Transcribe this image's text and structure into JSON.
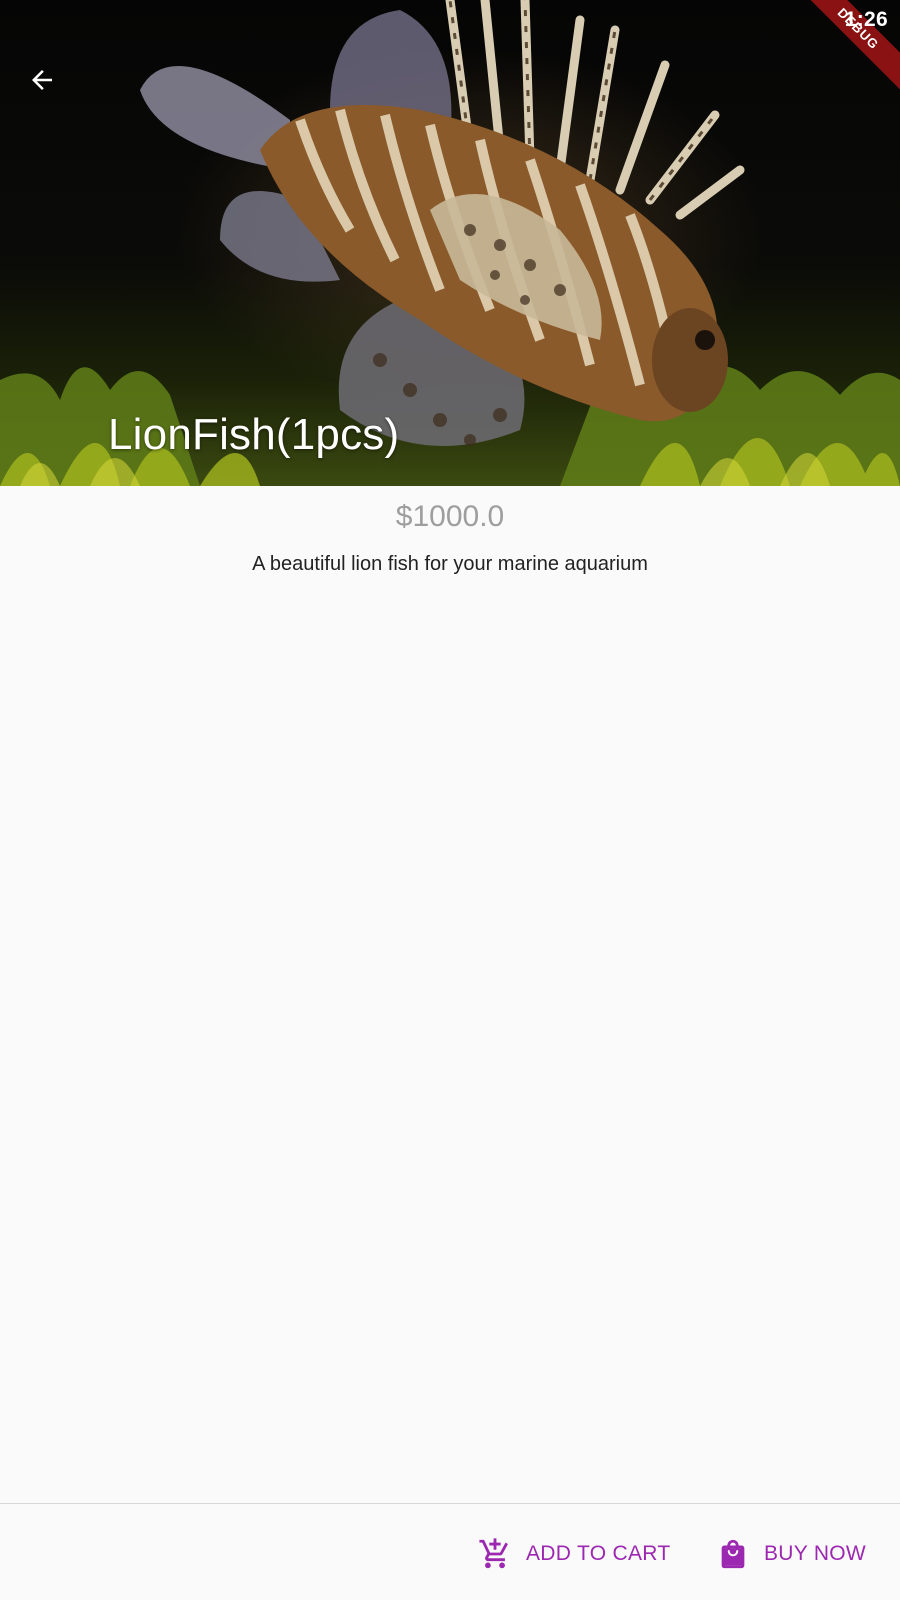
{
  "status_bar": {
    "time": "1:26",
    "debug_label": "DEBUG"
  },
  "header": {
    "back_icon": "arrow-back-icon",
    "title": "LionFish(1pcs)"
  },
  "product": {
    "price": "$1000.0",
    "description": "A beautiful lion fish for your marine aquarium"
  },
  "actions": {
    "add_to_cart": {
      "label": "ADD TO CART",
      "icon": "add-shopping-cart-icon"
    },
    "buy_now": {
      "label": "BUY NOW",
      "icon": "shopping-bag-icon"
    }
  },
  "colors": {
    "accent": "#9c27b0",
    "price_text": "#9e9e9e",
    "debug_banner": "#8a1212",
    "background": "#fafafa"
  }
}
